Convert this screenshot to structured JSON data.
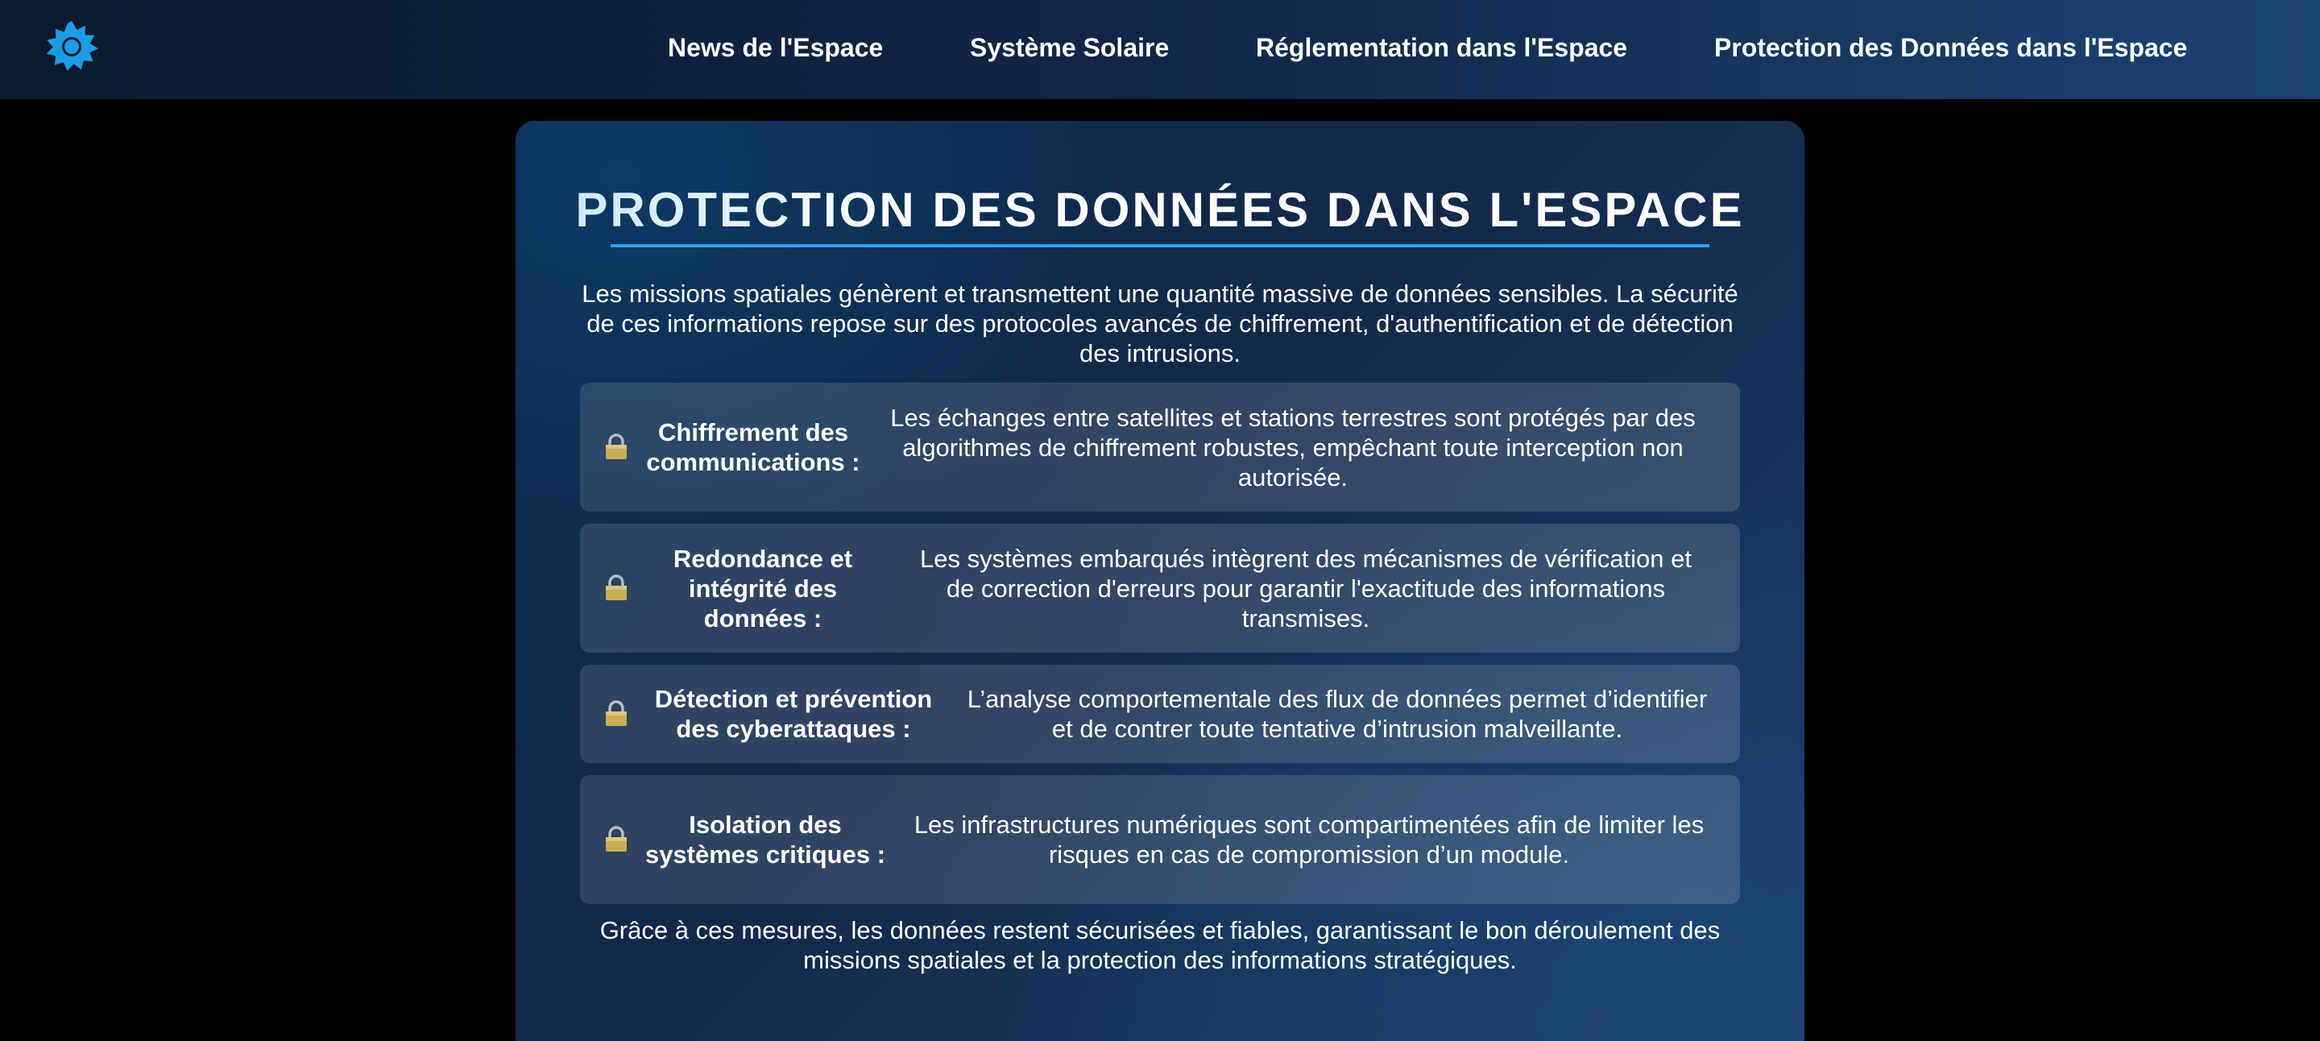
{
  "nav": {
    "logo_icon": "sun-gear-icon",
    "accent_color": "#1e9be6",
    "links": [
      {
        "label": "News de l'Espace"
      },
      {
        "label": "Système Solaire"
      },
      {
        "label": "Réglementation dans l'Espace"
      },
      {
        "label": "Protection des Données dans l'Espace"
      }
    ]
  },
  "main": {
    "title": "PROTECTION DES DONNÉES DANS L'ESPACE",
    "intro": "Les missions spatiales génèrent et transmettent une quantité massive de données sensibles. La sécurité de ces informations repose sur des protocoles avancés de chiffrement, d'authentification et de détection des intrusions.",
    "features": [
      {
        "icon": "lock-icon",
        "title": "Chiffrement des communications :",
        "description": "Les échanges entre satellites et stations terrestres sont protégés par des algorithmes de chiffrement robustes, empêchant toute interception non autorisée."
      },
      {
        "icon": "lock-icon",
        "title": "Redondance et intégrité des données :",
        "description": "Les systèmes embarqués intègrent des mécanismes de vérification et de correction d'erreurs pour garantir l'exactitude des informations transmises."
      },
      {
        "icon": "lock-icon",
        "title": "Détection et prévention des cyberattaques :",
        "description": "L’analyse comportementale des flux de données permet d’identifier et de contrer toute tentative d’intrusion malveillante."
      },
      {
        "icon": "lock-icon",
        "title": "Isolation des systèmes critiques :",
        "description": "Les infrastructures numériques sont compartimentées afin de limiter les risques en cas de compromission d’un module."
      }
    ],
    "outro": "Grâce à ces mesures, les données restent sécurisées et fiables, garantissant le bon déroulement des missions spatiales et la protection des informations stratégiques."
  }
}
